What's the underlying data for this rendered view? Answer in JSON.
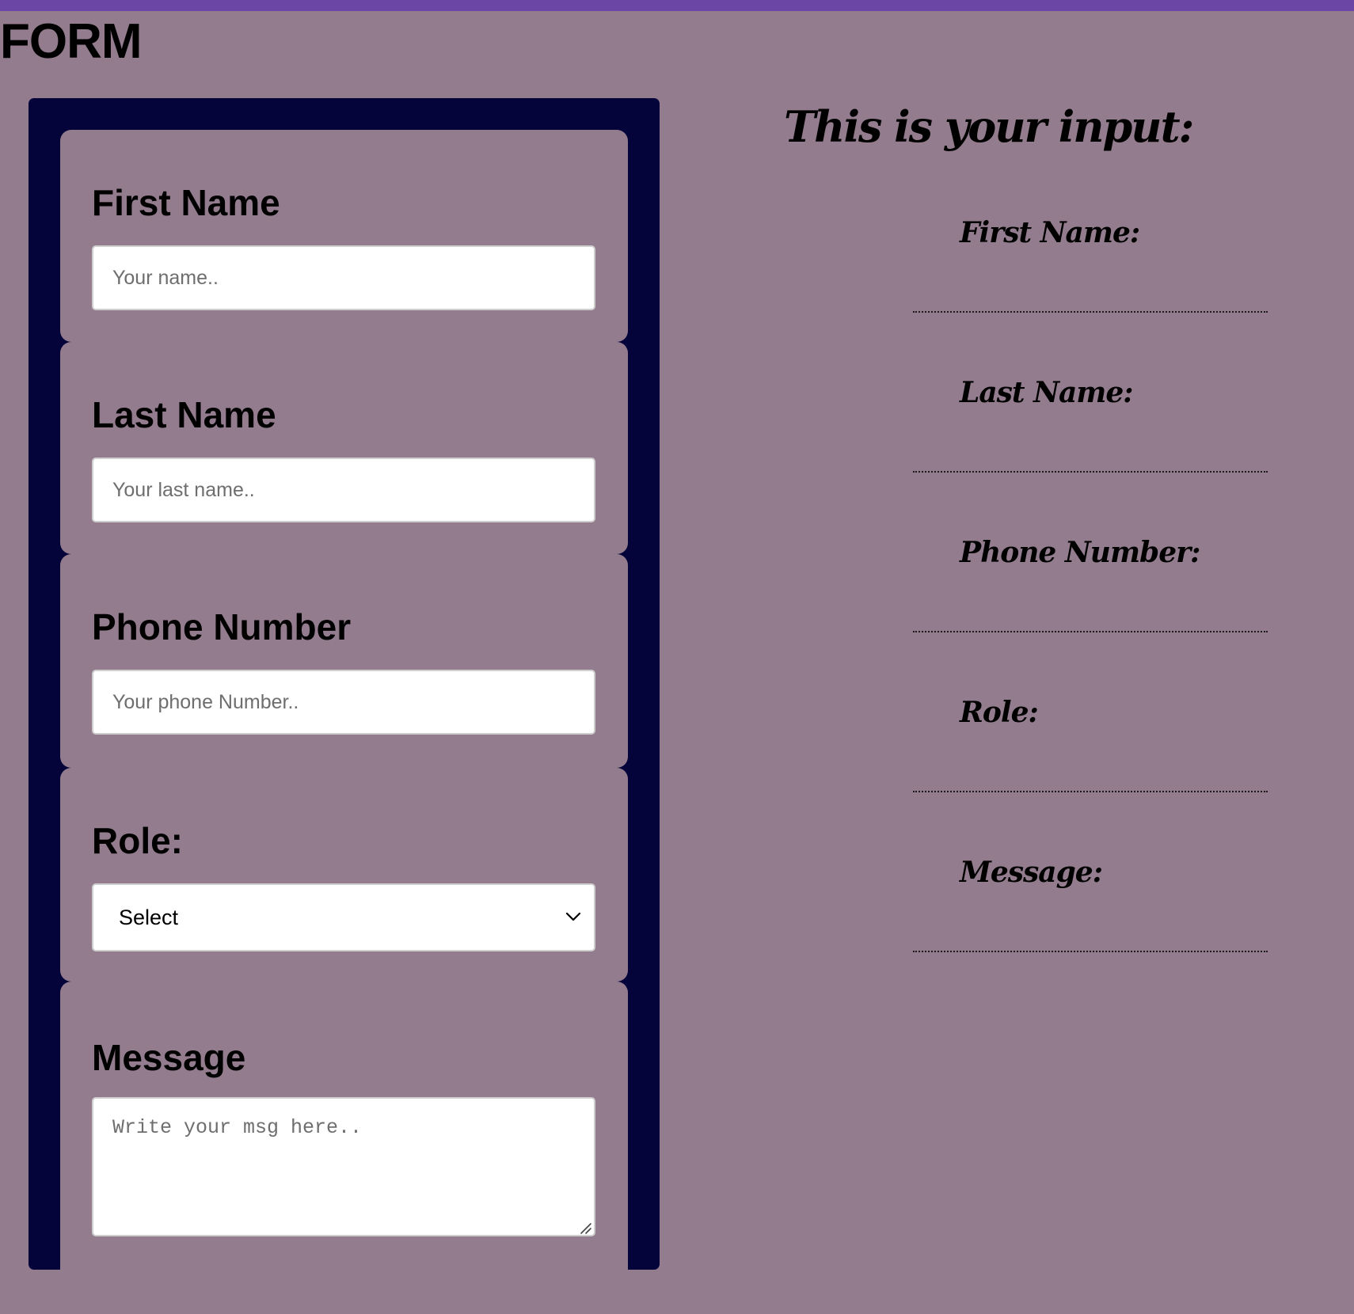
{
  "page": {
    "title": "FORM"
  },
  "form": {
    "first_name": {
      "label": "First Name",
      "placeholder": "Your name.."
    },
    "last_name": {
      "label": "Last Name",
      "placeholder": "Your last name.."
    },
    "phone": {
      "label": "Phone Number",
      "placeholder": "Your phone Number.."
    },
    "role": {
      "label": "Role:",
      "selected": "Select"
    },
    "message": {
      "label": "Message",
      "placeholder": "Write your msg here.."
    }
  },
  "preview": {
    "title": "This is your input:",
    "first_name_label": "First Name:",
    "last_name_label": "Last Name:",
    "phone_label": "Phone Number:",
    "role_label": "Role:",
    "message_label": "Message:"
  },
  "colors": {
    "background": "#937c8d",
    "top_bar": "#6b46a5",
    "form_frame": "#04033a",
    "input_background": "#ffffff"
  }
}
